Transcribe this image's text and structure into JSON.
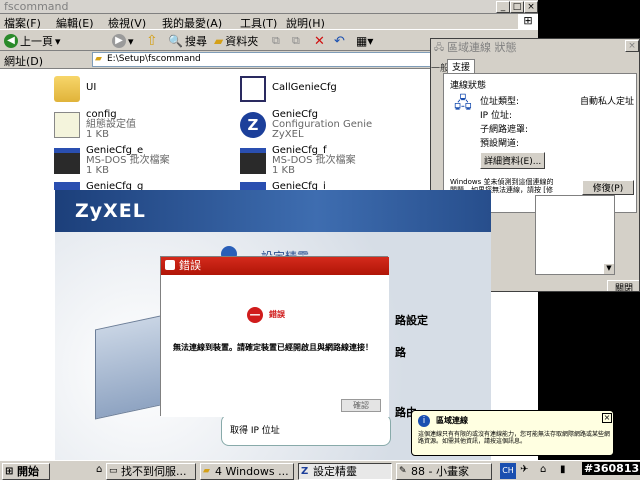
{
  "explorer": {
    "title": "fscommand",
    "menu": [
      "檔案(F)",
      "編輯(E)",
      "檢視(V)",
      "我的最愛(A)",
      "工具(T)",
      "說明(H)"
    ],
    "toolbar": {
      "back": "上一頁",
      "search": "搜尋",
      "folders": "資料夾"
    },
    "address_label": "網址(D)",
    "address_value": "E:\\Setup\\fscommand",
    "files": [
      {
        "name": "UI",
        "sub1": "",
        "sub2": ""
      },
      {
        "name": "CallGenieCfg",
        "sub1": "",
        "sub2": ""
      },
      {
        "name": "config",
        "sub1": "組態設定值",
        "sub2": "1 KB"
      },
      {
        "name": "GenieCfg",
        "sub1": "Configuration Genie",
        "sub2": "ZyXEL"
      },
      {
        "name": "GenieCfg_e",
        "sub1": "MS-DOS 批次檔案",
        "sub2": "1 KB"
      },
      {
        "name": "GenieCfg_f",
        "sub1": "MS-DOS 批次檔案",
        "sub2": "1 KB"
      },
      {
        "name": "GenieCfg_g",
        "sub1": "",
        "sub2": ""
      },
      {
        "name": "GenieCfg_i",
        "sub1": "",
        "sub2": ""
      }
    ]
  },
  "network": {
    "title": "區域連線 狀態",
    "tabs": [
      "一般",
      "支援"
    ],
    "group_label": "連線狀態",
    "rows": [
      {
        "k": "位址類型:",
        "v": "自動私人定址"
      },
      {
        "k": "IP 位址:",
        "v": ""
      },
      {
        "k": "子網路遮罩:",
        "v": ""
      },
      {
        "k": "預設閘道:",
        "v": ""
      }
    ],
    "details_button": "詳細資料(E)...",
    "note": "Windows 並未偵測到這個連線的問題，如果您無法連線，請按 [修復]。",
    "repair_button": "修復(P)",
    "close_button": "關閉"
  },
  "wizard": {
    "logo": "ZyXEL",
    "title": "設定精靈",
    "step1": "路設定",
    "step2": "路",
    "step3": "路由",
    "ip_label": "取得 IP 位址"
  },
  "error": {
    "title": "錯誤",
    "heading": "錯誤",
    "message": "無法連線到裝置。請確定裝置已經開啟且與網路線連接！",
    "ok": "確認"
  },
  "balloon": {
    "title": "區域連線",
    "text": "這個連線只有有限的或沒有連線能力，您可能無法存取網際網路或某些網路資源。如需其他資訊，請按這個訊息。"
  },
  "taskbar": {
    "start": "開始",
    "tasks": [
      "找不到伺服...",
      "4 Windows ...",
      "設定精靈",
      "88 - 小畫家"
    ],
    "tray": [
      "CH",
      "#360813"
    ]
  }
}
